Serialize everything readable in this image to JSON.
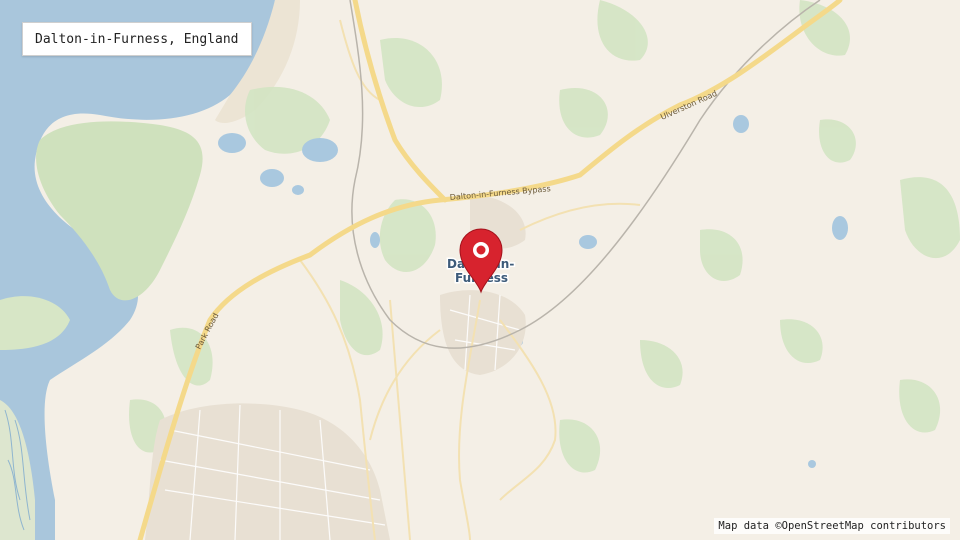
{
  "title": "Dalton-in-Furness, England",
  "attribution": "Map data ©OpenStreetMap contributors",
  "place_label": {
    "line1": "Dalton-in-",
    "line2": "Furness"
  },
  "road_labels": {
    "bypass": "Dalton-in-Furness Bypass",
    "ulverston": "Ulverston Road",
    "park": "Park Road"
  },
  "marker": {
    "icon": "map-pin-icon",
    "color": "#d7232e"
  },
  "colors": {
    "land": "#f4efe6",
    "water": "#a8c7dd",
    "green": "#cfe3c2",
    "major_road": "#f5dc8a",
    "urban": "#e9e2d6"
  }
}
